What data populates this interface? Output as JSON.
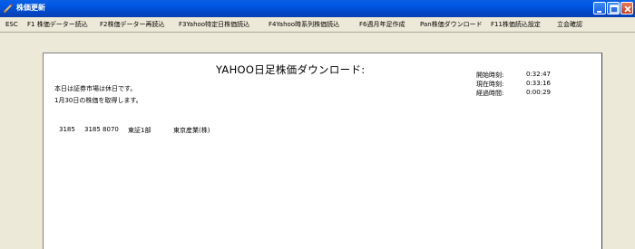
{
  "window": {
    "title": "株価更新"
  },
  "menu": [
    {
      "label": "ESC"
    },
    {
      "label": "F1 株価データー読込"
    },
    {
      "label": "F2株価データー再読込"
    },
    {
      "label": "F3Yahoo特定日株価読込"
    },
    {
      "label": "F4Yahoo時系列株価読込"
    },
    {
      "label": "F6週月年足作成"
    },
    {
      "label": "Pan株価ダウンロード"
    },
    {
      "label": "F11株価読込設定"
    },
    {
      "label": "立会確認"
    }
  ],
  "panel": {
    "heading": "YAHOO日足株価ダウンロード:",
    "message1": "本日は証券市場は休日です。",
    "message2": "1月30日の株価を取得します。",
    "times": [
      {
        "label": "開始時刻:",
        "value": "0:32:47"
      },
      {
        "label": "現在時刻:",
        "value": "0:33:16"
      },
      {
        "label": "経過時間:",
        "value": "0:00:29"
      }
    ],
    "row": {
      "code": "3185",
      "ticker": "3185 8070",
      "market": "東証1部",
      "name": "東京産業(株)"
    }
  }
}
